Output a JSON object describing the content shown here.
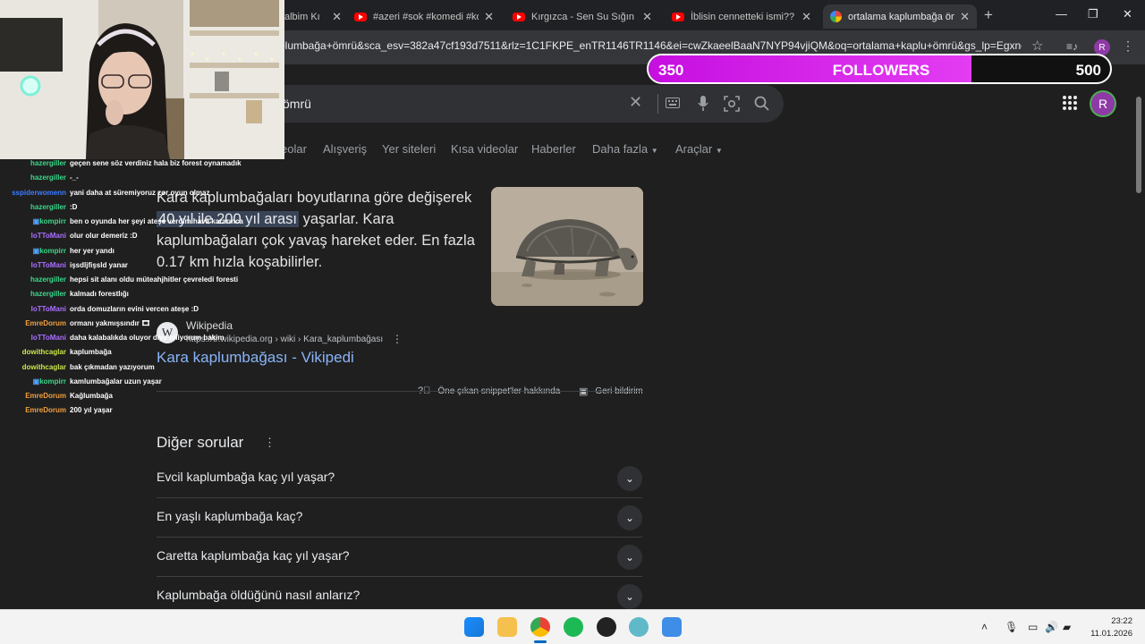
{
  "browser": {
    "tabs": [
      {
        "title": "albim Kı",
        "icon": "partial",
        "close": "✕"
      },
      {
        "title": "#azeri #sok #komedi #kon",
        "icon": "youtube",
        "close": "✕"
      },
      {
        "title": "Kırgızca - Sen Su Sığın Mis",
        "icon": "youtube",
        "close": "✕"
      },
      {
        "title": "İblisin cennetteki ismi?? 🤔",
        "icon": "youtube",
        "close": "✕"
      },
      {
        "title": "ortalama kaplumbağa ömı",
        "icon": "google",
        "close": "✕"
      }
    ],
    "new_tab": "+",
    "url": "plumbağa+ömrü&sca_esv=382a47cf193d7511&rlz=1C1FKPE_enTR1146TR1146&ei=cwZkaeelBaaN7NYP94vjiQM&oq=ortalama+kaplu+ömrü&gs_lp=Egxnd3...",
    "profile_letter": "R",
    "window_controls": {
      "minimize": "—",
      "restore": "❐",
      "close": "✕"
    }
  },
  "followers_widget": {
    "current": "350",
    "label": "FOLLOWERS",
    "goal": "500",
    "progress": 0.7
  },
  "search": {
    "query": "ömrü",
    "nav_items": [
      "eolar",
      "Alışveriş",
      "Yer siteleri",
      "Kısa videolar",
      "Haberler",
      "Daha fazla",
      "Araçlar"
    ],
    "avatar_letter": "R"
  },
  "snippet": {
    "text_before": "Kara kaplumbağaları boyutlarına göre değişerek ",
    "highlight": "40 yıl ile 200 yıl arası",
    "text_after": " yaşarlar. Kara kaplumbağaları çok yavaş hareket eder. En fazla 0.17 km hızla koşabilirler.",
    "source_logo": "W",
    "source_name": "Wikipedia",
    "source_url": "https://tr.wikipedia.org › wiki › Kara_kaplumbağası",
    "link_title": "Kara kaplumbağası - Vikipedi",
    "about_label": "Öne çıkan snippet'ler hakkında",
    "feedback_label": "Geri bildirim"
  },
  "others": {
    "title": "Diğer sorular",
    "questions": [
      "Evcil kaplumbağa kaç yıl yaşar?",
      "En yaşlı kaplumbağa kaç?",
      "Caretta kaplumbağa kaç yıl yaşar?",
      "Kaplumbağa öldüğünü nasıl anlarız?"
    ]
  },
  "chat": [
    {
      "user": "hazergiller",
      "color": "#39d98a",
      "msg": "geçen sene söz verdiniz hala biz forest oynamadık"
    },
    {
      "user": "hazergiller",
      "color": "#39d98a",
      "msg": "-_-"
    },
    {
      "user": "sspiderwomenn",
      "color": "#3d7bff",
      "msg": "yani daha at süremiyoruz zor oyun olmaz"
    },
    {
      "user": "hazergiller",
      "color": "#39d98a",
      "msg": ":D"
    },
    {
      "user": "kompirr",
      "color": "#39d98a",
      "msg": "ben o oyunda her şeyi ateşe verdim hava kararınca",
      "badge": true
    },
    {
      "user": "IoTToMani",
      "color": "#a970ff",
      "msg": "olur olur demeriz :D"
    },
    {
      "user": "kompirr",
      "color": "#39d98a",
      "msg": "her yer yandı",
      "badge": true
    },
    {
      "user": "IoTToMani",
      "color": "#a970ff",
      "msg": "işsdljfişsld yanar"
    },
    {
      "user": "hazergiller",
      "color": "#39d98a",
      "msg": "hepsi sit alanı oldu müteahjhitler çevreledi foresti"
    },
    {
      "user": "hazergiller",
      "color": "#39d98a",
      "msg": "kalmadı forestlığı"
    },
    {
      "user": "IoTToMani",
      "color": "#a970ff",
      "msg": "orda domuzların evini vercen ateşe :D"
    },
    {
      "user": "EmreDorum",
      "color": "#f0a040",
      "msg": "ormanı yakmışsındır 🎞"
    },
    {
      "user": "IoTToMani",
      "color": "#a970ff",
      "msg": "daha kalabalıkda oluyor diye biliyorum bakim"
    },
    {
      "user": "dowithcaglar",
      "color": "#c8e64a",
      "msg": "kaplumbağa"
    },
    {
      "user": "dowithcaglar",
      "color": "#c8e64a",
      "msg": "bak çıkmadan yazıyorum"
    },
    {
      "user": "kompirr",
      "color": "#39d98a",
      "msg": "kamlumbağalar uzun yaşar",
      "badge": true
    },
    {
      "user": "EmreDorum",
      "color": "#f0a040",
      "msg": "Kağlumbağa"
    },
    {
      "user": "EmreDorum",
      "color": "#f0a040",
      "msg": "200 yıl yaşar"
    }
  ],
  "taskbar": {
    "time": "23:22",
    "date": "11.01.2026"
  }
}
